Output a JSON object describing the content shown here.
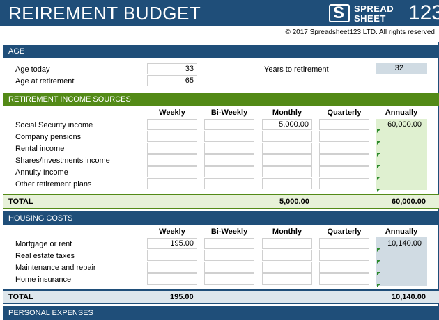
{
  "app": {
    "title": "REIREMENT BUDGET",
    "logo_top": "SPREAD",
    "logo_bottom": "SHEET",
    "logo_num": "123",
    "logo_letter": "S",
    "copyright": "© 2017 Spreadsheet123 LTD. All rights reserved"
  },
  "age": {
    "heading": "AGE",
    "today_label": "Age today",
    "today_value": "33",
    "retirement_label": "Age at retirement",
    "retirement_value": "65",
    "years_label": "Years to retirement",
    "years_value": "32"
  },
  "columns": [
    "Weekly",
    "Bi-Weekly",
    "Monthly",
    "Quarterly",
    "Annually"
  ],
  "income": {
    "heading": "RETIREMENT INCOME SOURCES",
    "rows": [
      {
        "label": "Social Security income",
        "weekly": "",
        "biweekly": "",
        "monthly": "5,000.00",
        "quarterly": "",
        "annually": "60,000.00"
      },
      {
        "label": "Company pensions",
        "weekly": "",
        "biweekly": "",
        "monthly": "",
        "quarterly": "",
        "annually": ""
      },
      {
        "label": "Rental income",
        "weekly": "",
        "biweekly": "",
        "monthly": "",
        "quarterly": "",
        "annually": ""
      },
      {
        "label": "Shares/Investments income",
        "weekly": "",
        "biweekly": "",
        "monthly": "",
        "quarterly": "",
        "annually": ""
      },
      {
        "label": "Annuity Income",
        "weekly": "",
        "biweekly": "",
        "monthly": "",
        "quarterly": "",
        "annually": ""
      },
      {
        "label": "Other retirement plans",
        "weekly": "",
        "biweekly": "",
        "monthly": "",
        "quarterly": "",
        "annually": ""
      }
    ],
    "total_label": "TOTAL",
    "total_monthly": "5,000.00",
    "total_annually": "60,000.00"
  },
  "housing": {
    "heading": "HOUSING COSTS",
    "rows": [
      {
        "label": "Mortgage or rent",
        "weekly": "195.00",
        "biweekly": "",
        "monthly": "",
        "quarterly": "",
        "annually": "10,140.00"
      },
      {
        "label": "Real estate taxes",
        "weekly": "",
        "biweekly": "",
        "monthly": "",
        "quarterly": "",
        "annually": ""
      },
      {
        "label": "Maintenance and repair",
        "weekly": "",
        "biweekly": "",
        "monthly": "",
        "quarterly": "",
        "annually": ""
      },
      {
        "label": "Home insurance",
        "weekly": "",
        "biweekly": "",
        "monthly": "",
        "quarterly": "",
        "annually": ""
      }
    ],
    "total_label": "TOTAL",
    "total_weekly": "195.00",
    "total_annually": "10,140.00"
  },
  "personal": {
    "heading": "PERSONAL EXPENSES"
  },
  "colors": {
    "header_blue": "#1f4e79",
    "income_green": "#538a17",
    "annual_green": "#dff0d0",
    "annual_blue": "#d0dbe3"
  }
}
